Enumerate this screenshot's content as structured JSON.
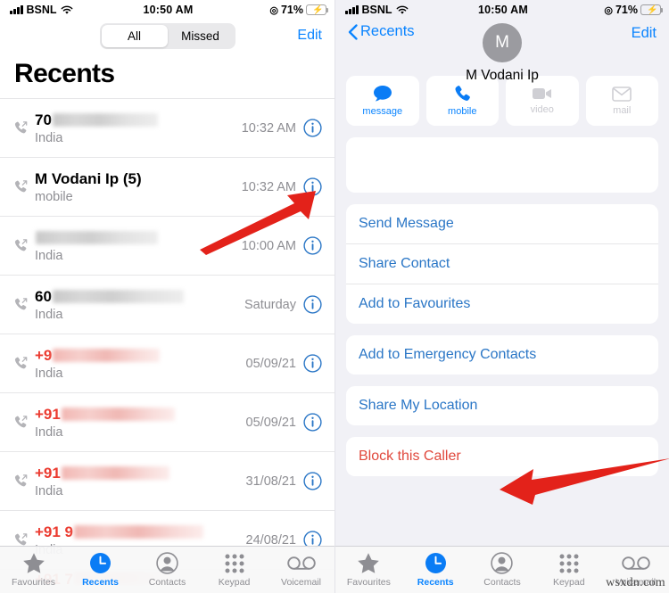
{
  "status_bar": {
    "carrier": "BSNL",
    "time": "10:50 AM",
    "battery_pct": "71%",
    "signal_icon": "signal-bars-icon",
    "wifi_icon": "wifi-icon",
    "location_icon": "location-services-icon",
    "battery_icon": "battery-charging-icon"
  },
  "left_screen": {
    "segmented": {
      "options": [
        "All",
        "Missed"
      ],
      "selected": "All"
    },
    "edit_label": "Edit",
    "title": "Recents",
    "calls": [
      {
        "name": "70",
        "blur_width": 118,
        "missed": false,
        "subtitle": "India",
        "time": "10:32 AM",
        "type_icon": "outgoing-call-icon"
      },
      {
        "name": "M Vodani Ip (5)",
        "blur_width": 0,
        "missed": false,
        "subtitle": "mobile",
        "time": "10:32 AM",
        "type_icon": "outgoing-call-icon"
      },
      {
        "name": "",
        "blur_width": 137,
        "missed": false,
        "subtitle": "India",
        "time": "10:00 AM",
        "type_icon": "outgoing-call-icon"
      },
      {
        "name": "60",
        "blur_width": 147,
        "missed": false,
        "subtitle": "India",
        "time": "Saturday",
        "type_icon": "outgoing-call-icon"
      },
      {
        "name": "+9",
        "blur_width": 120,
        "missed": true,
        "subtitle": "India",
        "time": "05/09/21",
        "type_icon": "missed-call-icon"
      },
      {
        "name": "+91",
        "blur_width": 127,
        "missed": true,
        "subtitle": "India",
        "time": "05/09/21",
        "type_icon": "missed-call-icon"
      },
      {
        "name": "+91",
        "blur_width": 121,
        "missed": true,
        "subtitle": "India",
        "time": "31/08/21",
        "type_icon": "missed-call-icon"
      },
      {
        "name": "+91 9",
        "blur_width": 145,
        "missed": true,
        "subtitle": "India",
        "time": "24/08/21",
        "type_icon": "missed-call-icon"
      }
    ],
    "partial_row": {
      "name": "+91 7",
      "blur_width": 110
    },
    "info_icon": "info-circle-icon",
    "annotation_arrow": "red-arrow-pointing-to-info-button"
  },
  "right_screen": {
    "back_label": "Recents",
    "edit_label": "Edit",
    "avatar_initial": "M",
    "contact_name": "M Vodani Ip",
    "actions": [
      {
        "label": "message",
        "icon": "message-bubble-icon",
        "enabled": true
      },
      {
        "label": "mobile",
        "icon": "phone-handset-icon",
        "enabled": true
      },
      {
        "label": "video",
        "icon": "video-camera-icon",
        "enabled": false
      },
      {
        "label": "mail",
        "icon": "envelope-icon",
        "enabled": false
      }
    ],
    "empty_card": "",
    "group_one": [
      "Send Message",
      "Share Contact",
      "Add to Favourites"
    ],
    "group_two": [
      "Add to Emergency Contacts"
    ],
    "group_three": [
      "Share My Location"
    ],
    "group_four": [
      "Block this Caller"
    ],
    "annotation_arrow": "red-arrow-pointing-to-block-this-caller"
  },
  "tabbar": {
    "items": [
      {
        "label": "Favourites",
        "icon": "star-icon",
        "active": false
      },
      {
        "label": "Recents",
        "icon": "clock-icon",
        "active": true
      },
      {
        "label": "Contacts",
        "icon": "person-circle-icon",
        "active": false
      },
      {
        "label": "Keypad",
        "icon": "keypad-dots-icon",
        "active": false
      },
      {
        "label": "Voicemail",
        "icon": "voicemail-icon",
        "active": false
      }
    ]
  },
  "watermark": "wsxdn.com",
  "colors": {
    "accent_blue": "#0a84ff",
    "link_blue": "#2a76c6",
    "missed_red": "#eb3b30",
    "danger_red": "#e0483c",
    "arrow_red": "#e3221a",
    "grey_text": "#8e8e93",
    "group_bg": "#f1f1f6"
  }
}
